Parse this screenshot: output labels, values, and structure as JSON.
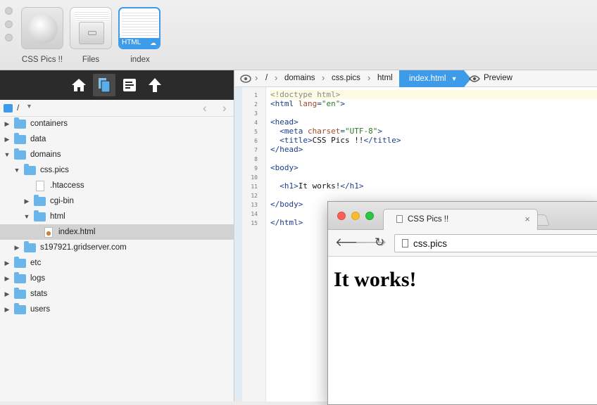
{
  "thumbnails": [
    {
      "label": "CSS Pics !!"
    },
    {
      "label": "Files"
    },
    {
      "label": "index",
      "badge": "HTML"
    }
  ],
  "sidebar": {
    "path": "/",
    "tree": [
      {
        "label": "containers",
        "type": "folder",
        "expanded": false
      },
      {
        "label": "data",
        "type": "folder",
        "expanded": false
      },
      {
        "label": "domains",
        "type": "folder",
        "expanded": true
      },
      {
        "label": "css.pics",
        "type": "folder",
        "expanded": true
      },
      {
        "label": ".htaccess",
        "type": "file"
      },
      {
        "label": "cgi-bin",
        "type": "folder",
        "expanded": false
      },
      {
        "label": "html",
        "type": "folder",
        "expanded": true
      },
      {
        "label": "index.html",
        "type": "file",
        "selected": true
      },
      {
        "label": "s197921.gridserver.com",
        "type": "folder",
        "expanded": false
      },
      {
        "label": "etc",
        "type": "folder",
        "expanded": false
      },
      {
        "label": "logs",
        "type": "folder",
        "expanded": false
      },
      {
        "label": "stats",
        "type": "folder",
        "expanded": false
      },
      {
        "label": "users",
        "type": "folder",
        "expanded": false
      }
    ]
  },
  "editor": {
    "breadcrumbs": [
      "/",
      "domains",
      "css.pics",
      "html",
      "index.html"
    ],
    "preview_label": "Preview",
    "lines": [
      {
        "n": "1",
        "text": "<!doctype html>"
      },
      {
        "n": "2",
        "text": "<html lang=\"en\">"
      },
      {
        "n": "3",
        "text": ""
      },
      {
        "n": "4",
        "text": "<head>"
      },
      {
        "n": "5",
        "text": "  <meta charset=\"UTF-8\">"
      },
      {
        "n": "6",
        "text": "  <title>CSS Pics !!</title>"
      },
      {
        "n": "7",
        "text": "</head>"
      },
      {
        "n": "8",
        "text": ""
      },
      {
        "n": "9",
        "text": "<body>"
      },
      {
        "n": "10",
        "text": ""
      },
      {
        "n": "11",
        "text": "  <h1>It works!</h1>"
      },
      {
        "n": "12",
        "text": ""
      },
      {
        "n": "13",
        "text": "</body>"
      },
      {
        "n": "14",
        "text": ""
      },
      {
        "n": "15",
        "text": "</html>"
      }
    ]
  },
  "browser": {
    "tab_title": "CSS Pics !!",
    "tab_close": "×",
    "address": "css.pics",
    "heading": "It works!"
  }
}
